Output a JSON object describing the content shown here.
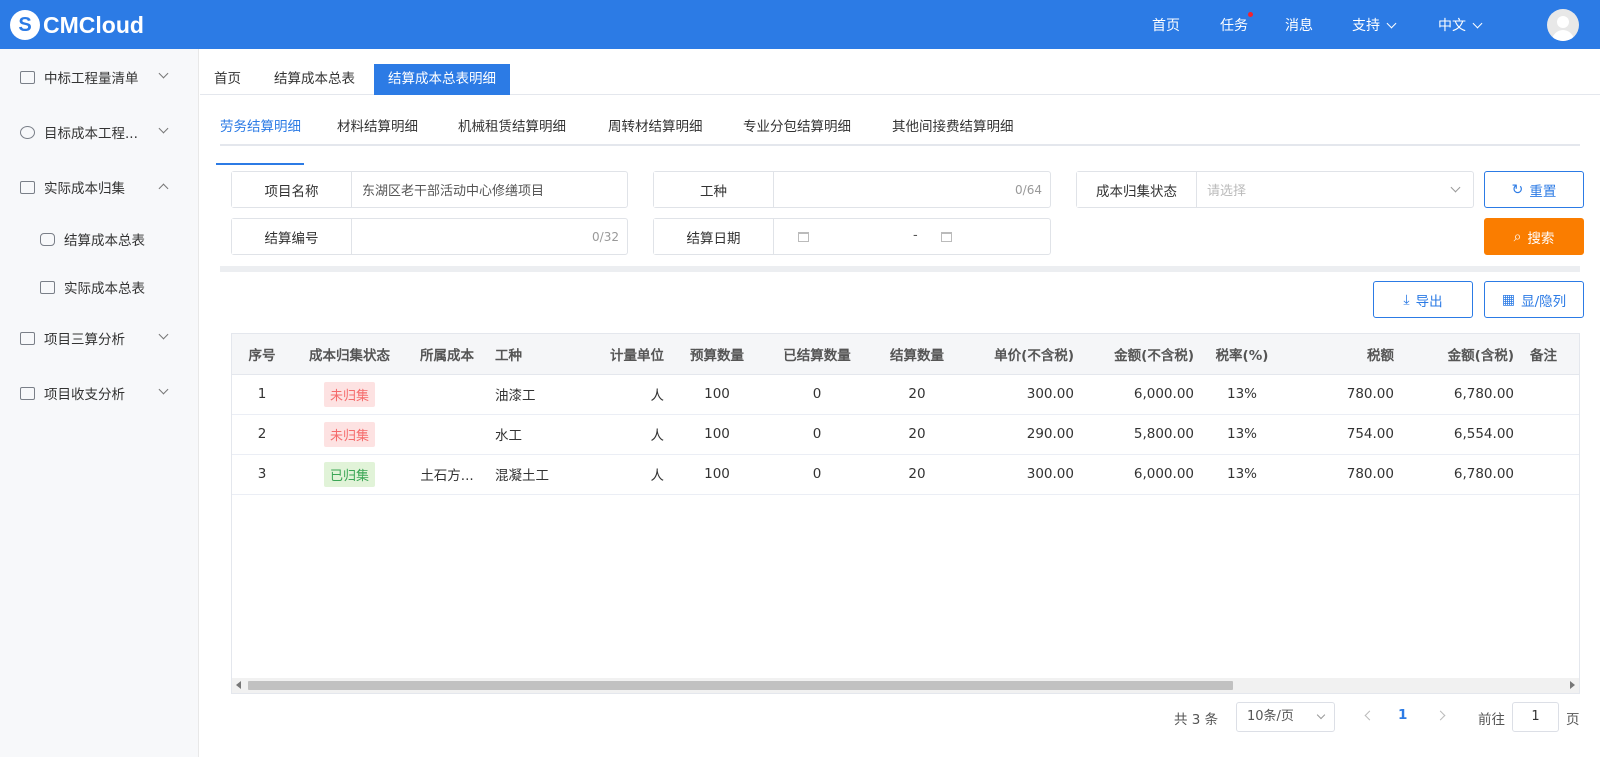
{
  "header": {
    "logo_letter": "S",
    "logo_text": "CMCloud",
    "nav": {
      "home": "首页",
      "tasks": "任务",
      "messages": "消息",
      "support": "支持",
      "language": "中文"
    },
    "colors": {
      "bar": "#2c7be5",
      "notification_dot": "#f5222d"
    }
  },
  "sidebar": {
    "items": [
      {
        "label": "中标工程量清单",
        "icon": "document-icon"
      },
      {
        "label": "目标成本工程...",
        "icon": "database-icon"
      },
      {
        "label": "实际成本归集",
        "icon": "checklist-icon",
        "expanded": true
      },
      {
        "label": "结算成本总表",
        "icon": "coins-icon"
      },
      {
        "label": "实际成本总表",
        "icon": "calculator-icon"
      },
      {
        "label": "项目三算分析",
        "icon": "report-icon"
      },
      {
        "label": "项目收支分析",
        "icon": "card-icon"
      }
    ]
  },
  "tabs": [
    {
      "label": "首页"
    },
    {
      "label": "结算成本总表"
    },
    {
      "label": "结算成本总表明细",
      "active": true
    }
  ],
  "subtabs": [
    {
      "label": "劳务结算明细",
      "active": true
    },
    {
      "label": "材料结算明细"
    },
    {
      "label": "机械租赁结算明细"
    },
    {
      "label": "周转材结算明细"
    },
    {
      "label": "专业分包结算明细"
    },
    {
      "label": "其他间接费结算明细"
    }
  ],
  "filters": {
    "project_name": {
      "label": "项目名称",
      "value": "东湖区老干部活动中心修缮项目"
    },
    "work_type": {
      "label": "工种",
      "value": "",
      "count": "0/64"
    },
    "cost_status": {
      "label": "成本归集状态",
      "placeholder": "请选择"
    },
    "settlement_no": {
      "label": "结算编号",
      "value": "",
      "count": "0/32"
    },
    "settlement_date": {
      "label": "结算日期",
      "separator": "-"
    }
  },
  "buttons": {
    "reset": "重置",
    "search": "搜索",
    "export": "导出",
    "columns": "显/隐列"
  },
  "table": {
    "columns": [
      "序号",
      "成本归集状态",
      "所属成本",
      "工种",
      "计量单位",
      "预算数量",
      "已结算数量",
      "结算数量",
      "单价(不含税)",
      "金额(不含税)",
      "税率(%)",
      "税额",
      "金额(含税)",
      "备注"
    ],
    "rows": [
      {
        "no": "1",
        "status": "未归集",
        "status_type": "red",
        "cost": "",
        "work": "油漆工",
        "unit": "人",
        "budget": "100",
        "settled": "0",
        "qty": "20",
        "price": "300.00",
        "amount": "6,000.00",
        "rate": "13%",
        "tax": "780.00",
        "total": "6,780.00",
        "remark": ""
      },
      {
        "no": "2",
        "status": "未归集",
        "status_type": "red",
        "cost": "",
        "work": "水工",
        "unit": "人",
        "budget": "100",
        "settled": "0",
        "qty": "20",
        "price": "290.00",
        "amount": "5,800.00",
        "rate": "13%",
        "tax": "754.00",
        "total": "6,554.00",
        "remark": ""
      },
      {
        "no": "3",
        "status": "已归集",
        "status_type": "green",
        "cost": "土石方...",
        "work": "混凝土工",
        "unit": "人",
        "budget": "100",
        "settled": "0",
        "qty": "20",
        "price": "300.00",
        "amount": "6,000.00",
        "rate": "13%",
        "tax": "780.00",
        "total": "6,780.00",
        "remark": ""
      }
    ]
  },
  "pagination": {
    "total": "共 3 条",
    "page_size": "10条/页",
    "current": "1",
    "goto_label": "前往",
    "goto_value": "1",
    "goto_unit": "页"
  }
}
